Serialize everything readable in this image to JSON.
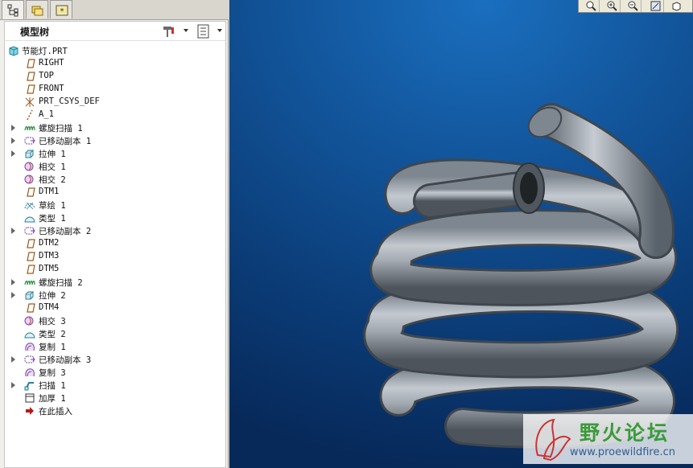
{
  "panel": {
    "title": "模型树",
    "tabs": [
      "model-tree-tab",
      "folder-browser-tab",
      "favorites-tab"
    ]
  },
  "tree": {
    "root": "节能灯.PRT",
    "items": [
      {
        "label": "RIGHT",
        "icon": "datum-plane-icon",
        "expandable": false
      },
      {
        "label": "TOP",
        "icon": "datum-plane-icon",
        "expandable": false
      },
      {
        "label": "FRONT",
        "icon": "datum-plane-icon",
        "expandable": false
      },
      {
        "label": "PRT_CSYS_DEF",
        "icon": "coordinate-system-icon",
        "expandable": false
      },
      {
        "label": "A_1",
        "icon": "datum-axis-icon",
        "expandable": false
      },
      {
        "label": "螺旋扫描 1",
        "icon": "helical-sweep-icon",
        "expandable": true
      },
      {
        "label": "已移动副本 1",
        "icon": "moved-copy-icon",
        "expandable": true
      },
      {
        "label": "拉伸 1",
        "icon": "extrude-icon",
        "expandable": true
      },
      {
        "label": "相交 1",
        "icon": "intersect-icon",
        "expandable": false
      },
      {
        "label": "相交 2",
        "icon": "intersect-icon",
        "expandable": false
      },
      {
        "label": "DTM1",
        "icon": "datum-plane-icon",
        "expandable": false
      },
      {
        "label": "草绘 1",
        "icon": "sketch-icon",
        "expandable": false
      },
      {
        "label": "类型 1",
        "icon": "type-icon",
        "expandable": false
      },
      {
        "label": "已移动副本 2",
        "icon": "moved-copy-icon",
        "expandable": true
      },
      {
        "label": "DTM2",
        "icon": "datum-plane-icon",
        "expandable": false
      },
      {
        "label": "DTM3",
        "icon": "datum-plane-icon",
        "expandable": false
      },
      {
        "label": "DTM5",
        "icon": "datum-plane-icon",
        "expandable": false
      },
      {
        "label": "螺旋扫描 2",
        "icon": "helical-sweep-icon",
        "expandable": true
      },
      {
        "label": "拉伸 2",
        "icon": "extrude-icon",
        "expandable": true
      },
      {
        "label": "DTM4",
        "icon": "datum-plane-icon",
        "expandable": false
      },
      {
        "label": "相交 3",
        "icon": "intersect-icon",
        "expandable": false
      },
      {
        "label": "类型 2",
        "icon": "type-icon",
        "expandable": false
      },
      {
        "label": "复制 1",
        "icon": "copy-icon",
        "expandable": false
      },
      {
        "label": "已移动副本 3",
        "icon": "moved-copy-icon",
        "expandable": true
      },
      {
        "label": "复制 3",
        "icon": "copy-icon",
        "expandable": false
      },
      {
        "label": "扫描 1",
        "icon": "sweep-icon",
        "expandable": true
      },
      {
        "label": "加厚 1",
        "icon": "thicken-icon",
        "expandable": false
      },
      {
        "label": "在此插入",
        "icon": "insert-here-arrow-icon",
        "expandable": false
      }
    ]
  },
  "viewport_toolbar": [
    "zoom-fit-icon",
    "zoom-in-icon",
    "zoom-out-icon",
    "repaint-icon",
    "orient-icon"
  ],
  "watermark": {
    "title": "野火论坛",
    "url": "www.proewildfire.cn"
  },
  "colors": {
    "viewport_top": "#1a6fbf",
    "viewport_bottom": "#07295a",
    "tube": "#9aa2ab"
  }
}
